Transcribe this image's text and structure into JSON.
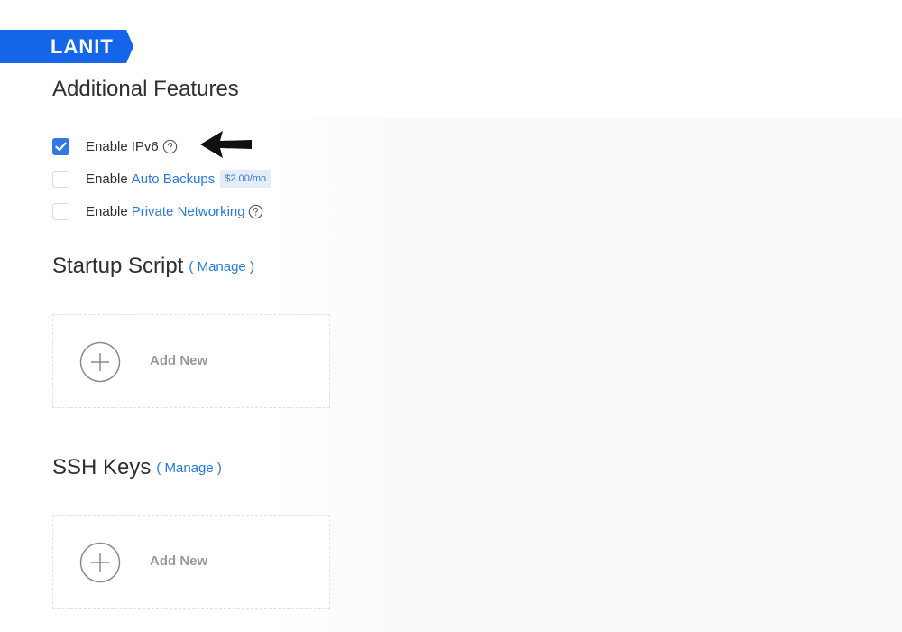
{
  "brand": {
    "logo_text": "LANIT",
    "banner_color": "#1565e8"
  },
  "additional_features": {
    "title": "Additional Features",
    "options": [
      {
        "prefix": "Enable",
        "label": "IPv6",
        "label_is_link": false,
        "checked": true,
        "help_icon": "question-circle-icon"
      },
      {
        "prefix": "Enable",
        "label": "Auto Backups",
        "label_is_link": true,
        "checked": false,
        "badge": "$2.00/mo"
      },
      {
        "prefix": "Enable",
        "label": "Private Networking",
        "label_is_link": true,
        "checked": false,
        "help_icon": "question-circle-icon"
      }
    ],
    "annotation_icon": "arrow-left-icon"
  },
  "startup_script": {
    "title": "Startup Script",
    "manage_label": "( Manage )",
    "add_label": "Add New",
    "add_icon": "plus-circle-icon"
  },
  "ssh_keys": {
    "title": "SSH Keys",
    "manage_label": "( Manage )",
    "add_label": "Add New",
    "add_icon": "plus-circle-icon"
  },
  "colors": {
    "accent": "#3377e0",
    "link": "#2b7ad4",
    "badge_bg": "#e3ecf8",
    "muted_text": "#9a9a9a"
  }
}
